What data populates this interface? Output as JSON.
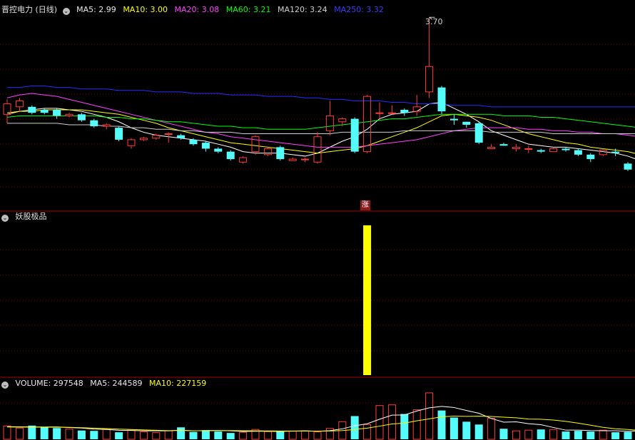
{
  "main_header": {
    "title": "晋控电力 (日线)",
    "ma5": "MA5: 2.99",
    "ma10": "MA10: 3.00",
    "ma20": "MA20: 3.08",
    "ma60": "MA60: 3.21",
    "ma120": "MA120: 3.24",
    "ma250": "MA250: 3.32"
  },
  "indicator_header": {
    "title": "妖股极品"
  },
  "volume_header": {
    "volume": "VOLUME: 297548",
    "ma5": "MA5: 244589",
    "ma10": "MA10: 227159"
  },
  "peak_label": "3.70",
  "signal_label": "涨",
  "colors": {
    "up": "#ff3b3b",
    "down": "#54fcfc",
    "ma5": "#ffffff",
    "ma10": "#ffff00",
    "ma20": "#ff40ff",
    "ma60": "#00ff00",
    "ma120": "#d0d0d0",
    "ma250": "#2a2aff",
    "signal": "#ffff00",
    "grid": "#7a0000"
  },
  "chart_data": [
    {
      "type": "candlestick",
      "title": "晋控电力 (日线)",
      "price_range": [
        2.55,
        3.72
      ],
      "candles": [
        [
          3.05,
          3.12,
          3.15,
          2.99
        ],
        [
          3.1,
          3.14,
          3.16,
          3.07
        ],
        [
          3.1,
          3.06,
          3.11,
          3.05
        ],
        [
          3.08,
          3.06,
          3.09,
          3.05
        ],
        [
          3.08,
          3.04,
          3.09,
          3.02
        ],
        [
          3.04,
          3.05,
          3.06,
          3.03
        ],
        [
          3.05,
          3.01,
          3.06,
          3.0
        ],
        [
          3.01,
          2.97,
          3.02,
          2.96
        ],
        [
          2.97,
          2.98,
          2.99,
          2.95
        ],
        [
          2.96,
          2.88,
          2.97,
          2.87
        ],
        [
          2.84,
          2.88,
          2.89,
          2.82
        ],
        [
          2.88,
          2.89,
          2.9,
          2.87
        ],
        [
          2.89,
          2.91,
          2.92,
          2.88
        ],
        [
          2.92,
          2.92,
          2.93,
          2.86
        ],
        [
          2.91,
          2.89,
          2.92,
          2.88
        ],
        [
          2.88,
          2.85,
          2.89,
          2.84
        ],
        [
          2.86,
          2.82,
          2.87,
          2.8
        ],
        [
          2.82,
          2.8,
          2.83,
          2.79
        ],
        [
          2.8,
          2.75,
          2.81,
          2.74
        ],
        [
          2.73,
          2.76,
          2.77,
          2.72
        ],
        [
          2.8,
          2.9,
          2.91,
          2.78
        ],
        [
          2.78,
          2.82,
          2.83,
          2.77
        ],
        [
          2.83,
          2.75,
          2.84,
          2.74
        ],
        [
          2.74,
          2.75,
          2.76,
          2.74
        ],
        [
          2.75,
          2.75,
          2.76,
          2.73
        ],
        [
          2.73,
          2.9,
          2.93,
          2.72
        ],
        [
          2.94,
          3.04,
          3.14,
          2.91
        ],
        [
          3.0,
          3.02,
          3.03,
          2.97
        ],
        [
          3.02,
          2.8,
          3.03,
          2.79
        ],
        [
          2.8,
          3.17,
          3.18,
          2.79
        ],
        [
          3.06,
          3.06,
          3.13,
          3.02
        ],
        [
          3.06,
          3.06,
          3.11,
          3.05
        ],
        [
          3.08,
          3.06,
          3.09,
          3.04
        ],
        [
          3.07,
          3.1,
          3.18,
          3.04
        ],
        [
          3.2,
          3.37,
          3.7,
          3.16
        ],
        [
          3.23,
          3.07,
          3.24,
          3.05
        ],
        [
          3.02,
          3.01,
          3.05,
          2.98
        ],
        [
          3.0,
          2.98,
          3.0,
          2.96
        ],
        [
          2.99,
          2.86,
          3.0,
          2.85
        ],
        [
          2.82,
          2.83,
          2.85,
          2.82
        ],
        [
          2.85,
          2.84,
          2.86,
          2.84
        ],
        [
          2.82,
          2.83,
          2.85,
          2.8
        ],
        [
          2.82,
          2.82,
          2.84,
          2.79
        ],
        [
          2.81,
          2.8,
          2.82,
          2.79
        ],
        [
          2.8,
          2.82,
          2.83,
          2.8
        ],
        [
          2.82,
          2.81,
          2.83,
          2.8
        ],
        [
          2.81,
          2.78,
          2.82,
          2.77
        ],
        [
          2.78,
          2.75,
          2.79,
          2.73
        ],
        [
          2.78,
          2.81,
          2.82,
          2.77
        ],
        [
          2.8,
          2.79,
          2.82,
          2.77
        ],
        [
          2.72,
          2.68,
          2.73,
          2.67
        ],
        [
          2.68,
          2.69,
          2.7,
          2.66
        ]
      ],
      "ma_series": [
        {
          "name": "MA5",
          "values": [
            3.05,
            3.07,
            3.08,
            3.09,
            3.09,
            3.08,
            3.07,
            3.05,
            3.03,
            3.0,
            2.96,
            2.93,
            2.91,
            2.9,
            2.89,
            2.88,
            2.87,
            2.85,
            2.83,
            2.8,
            2.79,
            2.79,
            2.79,
            2.78,
            2.77,
            2.79,
            2.83,
            2.87,
            2.9,
            2.95,
            3.02,
            3.05,
            3.06,
            3.07,
            3.12,
            3.13,
            3.09,
            3.05,
            3.0,
            2.94,
            2.91,
            2.88,
            2.85,
            2.84,
            2.83,
            2.83,
            2.82,
            2.81,
            2.8,
            2.79,
            2.77,
            2.74
          ]
        },
        {
          "name": "MA10",
          "values": [
            3.06,
            3.07,
            3.07,
            3.08,
            3.08,
            3.08,
            3.08,
            3.07,
            3.06,
            3.05,
            3.03,
            3.01,
            2.99,
            2.96,
            2.94,
            2.92,
            2.9,
            2.88,
            2.86,
            2.85,
            2.84,
            2.83,
            2.82,
            2.81,
            2.8,
            2.79,
            2.8,
            2.81,
            2.82,
            2.84,
            2.87,
            2.9,
            2.93,
            2.96,
            3.0,
            3.04,
            3.05,
            3.04,
            3.03,
            3.01,
            2.98,
            2.95,
            2.92,
            2.9,
            2.88,
            2.86,
            2.85,
            2.83,
            2.82,
            2.81,
            2.8,
            2.78
          ]
        },
        {
          "name": "MA20",
          "values": [
            3.16,
            3.18,
            3.19,
            3.18,
            3.17,
            3.15,
            3.13,
            3.11,
            3.09,
            3.07,
            3.05,
            3.03,
            3.01,
            2.99,
            2.97,
            2.95,
            2.93,
            2.92,
            2.9,
            2.89,
            2.88,
            2.87,
            2.86,
            2.85,
            2.84,
            2.83,
            2.83,
            2.83,
            2.83,
            2.84,
            2.85,
            2.86,
            2.87,
            2.88,
            2.9,
            2.92,
            2.94,
            2.95,
            2.96,
            2.96,
            2.96,
            2.96,
            2.95,
            2.95,
            2.94,
            2.94,
            2.93,
            2.93,
            2.92,
            2.92,
            2.91,
            2.9
          ]
        },
        {
          "name": "MA60",
          "values": [
            3.03,
            3.04,
            3.04,
            3.04,
            3.04,
            3.04,
            3.04,
            3.04,
            3.03,
            3.03,
            3.02,
            3.02,
            3.01,
            3.0,
            3.0,
            2.99,
            2.98,
            2.97,
            2.97,
            2.96,
            2.96,
            2.95,
            2.95,
            2.95,
            2.95,
            2.96,
            2.97,
            2.98,
            2.99,
            3.0,
            3.01,
            3.02,
            3.02,
            3.03,
            3.04,
            3.05,
            3.05,
            3.05,
            3.05,
            3.05,
            3.04,
            3.04,
            3.04,
            3.03,
            3.03,
            3.02,
            3.01,
            3.0,
            2.99,
            2.98,
            2.97,
            2.96
          ]
        },
        {
          "name": "MA120",
          "values": [
            2.99,
            2.99,
            2.99,
            2.99,
            2.99,
            2.98,
            2.98,
            2.98,
            2.97,
            2.97,
            2.96,
            2.96,
            2.95,
            2.95,
            2.94,
            2.94,
            2.93,
            2.93,
            2.93,
            2.92,
            2.92,
            2.92,
            2.92,
            2.92,
            2.92,
            2.92,
            2.92,
            2.93,
            2.93,
            2.93,
            2.93,
            2.93,
            2.94,
            2.94,
            2.94,
            2.94,
            2.94,
            2.94,
            2.94,
            2.93,
            2.93,
            2.93,
            2.93,
            2.93,
            2.92,
            2.92,
            2.92,
            2.92,
            2.92,
            2.92,
            2.92,
            2.92
          ]
        },
        {
          "name": "MA250",
          "values": [
            3.23,
            3.23,
            3.24,
            3.24,
            3.23,
            3.23,
            3.22,
            3.22,
            3.22,
            3.21,
            3.21,
            3.21,
            3.2,
            3.2,
            3.2,
            3.19,
            3.19,
            3.19,
            3.18,
            3.18,
            3.18,
            3.17,
            3.17,
            3.17,
            3.16,
            3.16,
            3.15,
            3.15,
            3.14,
            3.14,
            3.14,
            3.13,
            3.13,
            3.12,
            3.12,
            3.12,
            3.11,
            3.11,
            3.11,
            3.1,
            3.1,
            3.1,
            3.1,
            3.1,
            3.1,
            3.1,
            3.1,
            3.1,
            3.1,
            3.1,
            3.1,
            3.1
          ]
        }
      ]
    },
    {
      "type": "bar",
      "title": "妖股极品",
      "signal_index": 29,
      "values": [
        0,
        0,
        0,
        0,
        0,
        0,
        0,
        0,
        0,
        0,
        0,
        0,
        0,
        0,
        0,
        0,
        0,
        0,
        0,
        0,
        0,
        0,
        0,
        0,
        0,
        0,
        0,
        0,
        0,
        1,
        0,
        0,
        0,
        0,
        0,
        0,
        0,
        0,
        0,
        0,
        0,
        0,
        0,
        0,
        0,
        0,
        0,
        0,
        0,
        0,
        0,
        0
      ]
    },
    {
      "type": "bar",
      "title": "VOLUME",
      "ylim": [
        0,
        700000
      ],
      "values": [
        190000,
        160000,
        195000,
        175000,
        160000,
        145000,
        125000,
        120000,
        150000,
        100000,
        130000,
        105000,
        95000,
        120000,
        170000,
        105000,
        130000,
        110000,
        90000,
        100000,
        140000,
        110000,
        120000,
        115000,
        120000,
        105000,
        155000,
        250000,
        330000,
        210000,
        480000,
        490000,
        360000,
        420000,
        660000,
        410000,
        310000,
        250000,
        210000,
        300000,
        150000,
        120000,
        130000,
        140000,
        140000,
        110000,
        120000,
        110000,
        130000,
        100000,
        105000,
        140000
      ],
      "ma_series": [
        {
          "name": "MA5",
          "values": [
            180000,
            178000,
            176000,
            175000,
            176000,
            167000,
            160000,
            145000,
            140000,
            128000,
            125000,
            120000,
            120000,
            120000,
            130000,
            120000,
            124000,
            126000,
            121000,
            111000,
            114000,
            114000,
            112000,
            117000,
            121000,
            114000,
            123000,
            149000,
            192000,
            221000,
            285000,
            344000,
            346000,
            402000,
            448000,
            468000,
            452000,
            410000,
            370000,
            296000,
            244000,
            248000,
            222000,
            208000,
            168000,
            130000,
            130000,
            124000,
            122000,
            122000,
            113000,
            121000
          ]
        },
        {
          "name": "MA10",
          "values": [
            175000,
            174000,
            173000,
            172000,
            171000,
            170000,
            165000,
            158000,
            152000,
            145000,
            140000,
            133000,
            128000,
            123000,
            125000,
            122000,
            122000,
            123000,
            124000,
            122000,
            121000,
            119000,
            118000,
            118000,
            117000,
            116000,
            118000,
            124000,
            140000,
            159000,
            187000,
            218000,
            230000,
            262000,
            290000,
            320000,
            330000,
            326000,
            329000,
            325000,
            315000,
            306000,
            288000,
            285000,
            274000,
            255000,
            230000,
            200000,
            170000,
            150000,
            140000,
            125000
          ]
        }
      ]
    }
  ]
}
